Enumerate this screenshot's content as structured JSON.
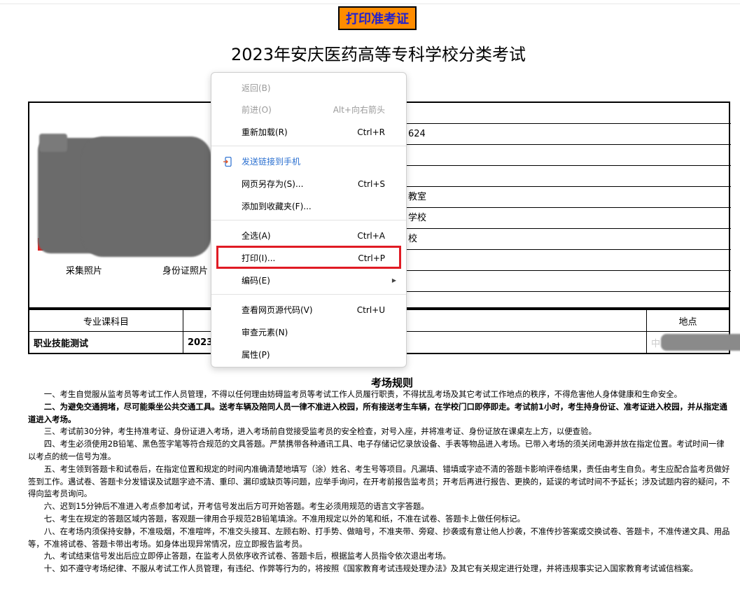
{
  "header": {
    "print_button": "打印准考证",
    "title": "2023年安庆医药高等专科学校分类考试"
  },
  "photos": {
    "capture_label": "采集照片",
    "id_label": "身份证照片"
  },
  "info_rows": [
    "",
    "624",
    "",
    "",
    "教室",
    "学校",
    "校",
    "",
    "",
    ""
  ],
  "subject_table": {
    "headers": [
      "专业课科目",
      "",
      "",
      "地点"
    ],
    "row": [
      "职业技能测试",
      "2023",
      "",
      "中"
    ]
  },
  "rules": {
    "title": "考场规则",
    "items": [
      "一、考生自觉服从监考员等考试工作人员管理，不得以任何理由妨碍监考员等考试工作人员履行职责，不得扰乱考场及其它考试工作地点的秩序，不得危害他人身体健康和生命安全。",
      "二、为避免交通拥堵，尽可能乘坐公共交通工具。送考车辆及陪同人员一律不准进入校园，所有接送考生车辆，在学校门口即停即走。考试前1小时，考生持身份证、准考证进入校园，并从指定通道进入考场。",
      "三、考试前30分钟，考生持准考证、身份证进入考场，进入考场前自觉接受监考员的安全检查，对号入座，并将准考证、身份证放在课桌左上方，以便查验。",
      "四、考生必须使用2B铅笔、黑色签字笔等符合规范的文具答题。严禁携带各种通讯工具、电子存储记忆录放设备、手表等物品进入考场。已带入考场的须关闭电源并放在指定位置。考试时间一律以考点的统一信号为准。",
      "五、考生领到答题卡和试卷后，在指定位置和规定的时间内准确清楚地填写（涂）姓名、考生号等项目。凡漏填、错填或字迹不清的答题卡影响评卷结果，责任由考生自负。考生应配合监考员做好签到工作。遇试卷、答题卡分发错误及试题字迹不清、重印、漏印或缺页等问题，应举手询问，在开考前报告监考员；开考后再进行报告、更换的，延误的考试时间不予延长；涉及试题内容的疑问，不得向监考员询问。",
      "六、迟到15分钟后不准进入考点参加考试，开考信号发出后方可开始答题。考生必须用规范的语言文字答题。",
      "七、考生在规定的答题区域内答题，客观题一律用合乎规范2B铅笔填涂。不准用规定以外的笔和纸，不准在试卷、答题卡上做任何标记。",
      "八、在考场内须保持安静，不准吸烟，不准喧哗，不准交头接耳、左顾右盼、打手势、做暗号，不准夹带、旁窥、抄袭或有意让他人抄袭，不准传抄答案或交换试卷、答题卡，不准传递文具、用品等，不准将试卷、答题卡带出考场。如身体出现异常情况，应立即报告监考员。",
      "九、考试结束信号发出后应立即停止答题，在监考人员依序收齐试卷、答题卡后，根据监考人员指令依次退出考场。",
      "十、如不遵守考场纪律、不服从考试工作人员管理，有违纪、作弊等行为的，将按照《国家教育考试违规处理办法》及其它有关规定进行处理，并将违规事实记入国家教育考试诚信档案。"
    ]
  },
  "context_menu": {
    "items": [
      {
        "label": "返回(B)",
        "shortcut": "",
        "state": "disabled"
      },
      {
        "label": "前进(O)",
        "shortcut": "Alt+向右箭头",
        "state": "disabled"
      },
      {
        "label": "重新加载(R)",
        "shortcut": "Ctrl+R",
        "state": "normal"
      },
      {
        "label": "发送链接到手机",
        "shortcut": "",
        "state": "accent"
      },
      {
        "label": "网页另存为(S)...",
        "shortcut": "Ctrl+S",
        "state": "normal"
      },
      {
        "label": "添加到收藏夹(F)...",
        "shortcut": "",
        "state": "normal"
      },
      {
        "label": "全选(A)",
        "shortcut": "Ctrl+A",
        "state": "normal"
      },
      {
        "label": "打印(I)...",
        "shortcut": "Ctrl+P",
        "state": "highlighted"
      },
      {
        "label": "编码(E)",
        "shortcut": "",
        "state": "submenu"
      },
      {
        "label": "查看网页源代码(V)",
        "shortcut": "Ctrl+U",
        "state": "normal"
      },
      {
        "label": "审查元素(N)",
        "shortcut": "",
        "state": "normal"
      },
      {
        "label": "属性(P)",
        "shortcut": "",
        "state": "normal"
      }
    ],
    "highlight_color": "#e01b24",
    "accent_color": "#2a6fd0"
  }
}
